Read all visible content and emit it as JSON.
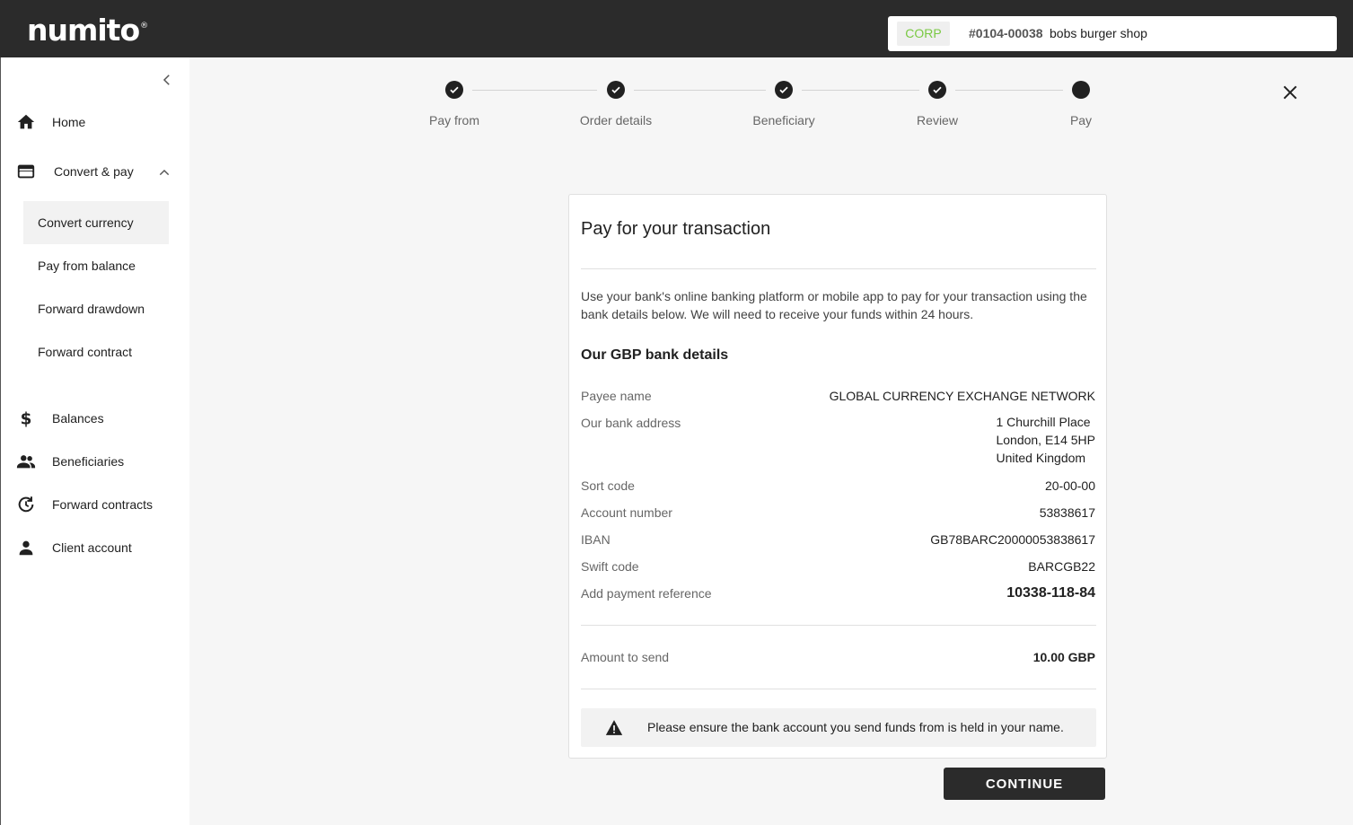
{
  "app": {
    "logo": "numito",
    "logo_mark": "®"
  },
  "account": {
    "type_badge": "CORP",
    "number": "#0104-00038",
    "name": "bobs burger shop"
  },
  "sidebar": {
    "items": [
      {
        "label": "Home",
        "icon": "home-icon"
      },
      {
        "label": "Convert & pay",
        "icon": "card-icon",
        "expanded": true
      },
      {
        "label": "Balances",
        "icon": "dollar-icon"
      },
      {
        "label": "Beneficiaries",
        "icon": "people-icon"
      },
      {
        "label": "Forward contracts",
        "icon": "history-icon"
      },
      {
        "label": "Client account",
        "icon": "person-icon"
      }
    ],
    "sub_items": [
      {
        "label": "Convert currency",
        "active": true
      },
      {
        "label": "Pay from balance"
      },
      {
        "label": "Forward drawdown"
      },
      {
        "label": "Forward contract"
      }
    ]
  },
  "stepper": {
    "steps": [
      {
        "label": "Pay from",
        "state": "complete"
      },
      {
        "label": "Order details",
        "state": "complete"
      },
      {
        "label": "Beneficiary",
        "state": "complete"
      },
      {
        "label": "Review",
        "state": "complete"
      },
      {
        "label": "Pay",
        "state": "current"
      }
    ]
  },
  "card": {
    "title": "Pay for your transaction",
    "intro": "Use your bank's online banking platform or mobile app to pay for your transaction using the bank details below. We will need to receive your funds within 24 hours.",
    "section_title": "Our GBP bank details",
    "details": {
      "payee_label": "Payee name",
      "payee_value": "GLOBAL CURRENCY EXCHANGE NETWORK",
      "address_label": "Our bank address",
      "address_lines": [
        "1 Churchill Place",
        "London, E14 5HP",
        "United Kingdom"
      ],
      "sort_label": "Sort code",
      "sort_value": "20-00-00",
      "account_label": "Account number",
      "account_value": "53838617",
      "iban_label": "IBAN",
      "iban_value": "GB78BARC20000053838617",
      "swift_label": "Swift code",
      "swift_value": "BARCGB22",
      "ref_label": "Add payment reference",
      "ref_value": "10338-118-84"
    },
    "amount_label": "Amount to send",
    "amount_value": "10.00 GBP",
    "warning": "Please ensure the bank account you send funds from is held in your name."
  },
  "actions": {
    "continue_label": "CONTINUE"
  },
  "colors": {
    "topbar": "#2b2b2b",
    "corp_badge_text": "#7ac943",
    "primary_button": "#2b2b2b"
  }
}
